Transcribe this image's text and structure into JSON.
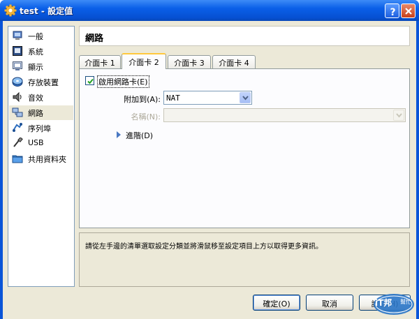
{
  "window": {
    "title": "test - 設定值",
    "icon": "gear-icon"
  },
  "sidebar": {
    "items": [
      {
        "label": "一般",
        "icon": "computer-icon"
      },
      {
        "label": "系統",
        "icon": "motherboard-icon"
      },
      {
        "label": "顯示",
        "icon": "monitor-icon"
      },
      {
        "label": "存放裝置",
        "icon": "disk-icon"
      },
      {
        "label": "音效",
        "icon": "speaker-icon"
      },
      {
        "label": "網路",
        "icon": "network-icon",
        "selected": true
      },
      {
        "label": "序列埠",
        "icon": "serial-port-icon"
      },
      {
        "label": "USB",
        "icon": "usb-icon"
      },
      {
        "label": "共用資料夾",
        "icon": "folder-icon"
      }
    ]
  },
  "section": {
    "title": "網路"
  },
  "tabs": [
    {
      "label": "介面卡 1"
    },
    {
      "label": "介面卡 2",
      "active": true
    },
    {
      "label": "介面卡 3"
    },
    {
      "label": "介面卡 4"
    }
  ],
  "adapter": {
    "enable_label": "啟用網路卡(E)",
    "enabled": true,
    "attached_label": "附加到(A):",
    "attached_value": "NAT",
    "name_label": "名稱(N):",
    "name_value": "",
    "advanced_label": "進階(D)"
  },
  "info": {
    "text": "請從左手邊的清單選取設定分類並將滑鼠移至設定項目上方以取得更多資訊。"
  },
  "buttons": {
    "ok": "確定(O)",
    "cancel": "取消",
    "help": "說明(H)"
  },
  "watermark": {
    "main": "iT邦",
    "sub": "幫忙"
  },
  "colors": {
    "titlebar": "#0a5fe8",
    "accent_tab": "#ffc83c",
    "selection": "#ece9d8"
  }
}
